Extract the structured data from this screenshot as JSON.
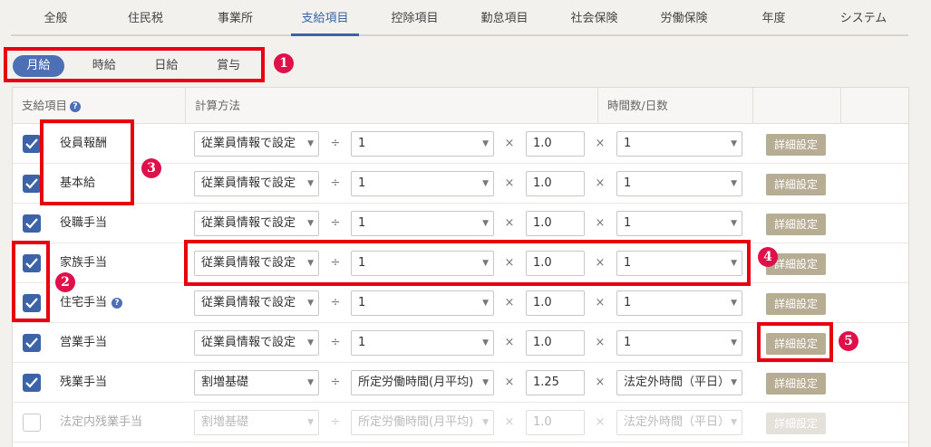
{
  "topnav": {
    "tabs": [
      "全般",
      "住民税",
      "事業所",
      "支給項目",
      "控除項目",
      "勤怠項目",
      "社会保険",
      "労働保険",
      "年度",
      "システム"
    ],
    "active_index": 3
  },
  "pay_types": [
    "月給",
    "時給",
    "日給",
    "賞与"
  ],
  "table": {
    "headers": {
      "item": "支給項目",
      "method": "計算方法",
      "hours": "時間数/日数"
    },
    "rows": [
      {
        "name": "役員報酬",
        "checked": true,
        "method": "従業員情報で設定",
        "divisor": "1",
        "factor": "1.0",
        "hours": "1",
        "detail": "詳細設定"
      },
      {
        "name": "基本給",
        "checked": true,
        "method": "従業員情報で設定",
        "divisor": "1",
        "factor": "1.0",
        "hours": "1",
        "detail": "詳細設定"
      },
      {
        "name": "役職手当",
        "checked": true,
        "method": "従業員情報で設定",
        "divisor": "1",
        "factor": "1.0",
        "hours": "1",
        "detail": "詳細設定"
      },
      {
        "name": "家族手当",
        "checked": true,
        "method": "従業員情報で設定",
        "divisor": "1",
        "factor": "1.0",
        "hours": "1",
        "detail": "詳細設定"
      },
      {
        "name": "住宅手当",
        "checked": true,
        "method": "従業員情報で設定",
        "divisor": "1",
        "factor": "1.0",
        "hours": "1",
        "detail": "詳細設定"
      },
      {
        "name": "営業手当",
        "checked": true,
        "method": "従業員情報で設定",
        "divisor": "1",
        "factor": "1.0",
        "hours": "1",
        "detail": "詳細設定"
      },
      {
        "name": "残業手当",
        "checked": true,
        "method": "割増基礎",
        "divisor": "所定労働時間(月平均)",
        "factor": "1.25",
        "hours": "法定外時間（平日）",
        "detail": "詳細設定"
      },
      {
        "name": "法定内残業手当",
        "checked": false,
        "method": "割増基礎",
        "divisor": "所定労働時間(月平均)",
        "factor": "1.0",
        "hours": "法定外時間（平日）",
        "detail": "詳細設定"
      }
    ]
  },
  "ops": {
    "divide": "÷",
    "times": "×"
  },
  "annotations": [
    "1",
    "2",
    "3",
    "4",
    "5"
  ],
  "colors": {
    "accent": "#3a63a8",
    "button": "#b7ad95",
    "annotation": "#e8000f"
  }
}
